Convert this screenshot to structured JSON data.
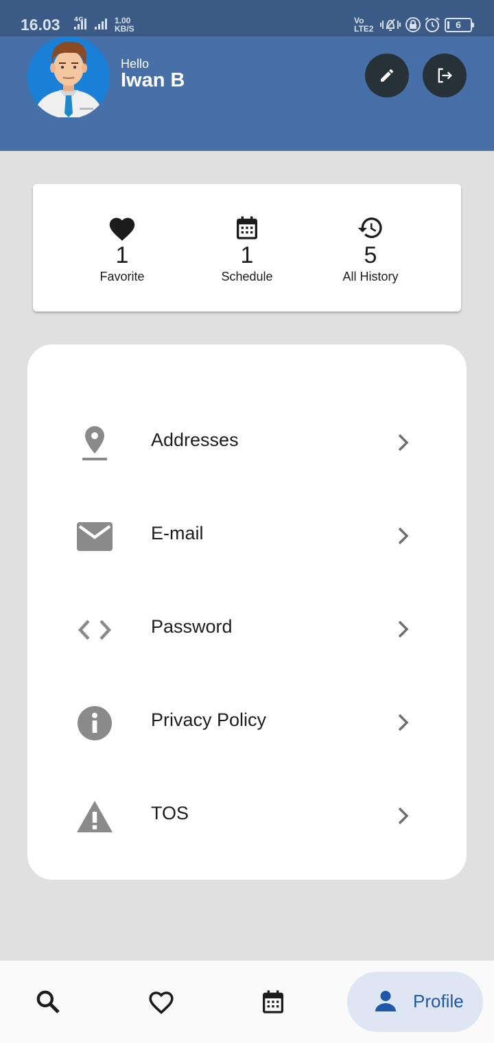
{
  "status_bar": {
    "time": "16.03",
    "network": "4G",
    "speed_value": "1.00",
    "speed_unit": "KB/S",
    "volte_top": "Vo",
    "volte_bottom": "LTE2",
    "battery": "6",
    "icons": [
      "signal-icon",
      "signal-icon",
      "vibrate-icon",
      "lock-icon",
      "alarm-icon",
      "battery-icon"
    ]
  },
  "header": {
    "greeting": "Hello",
    "user_name": "Iwan B",
    "edit_icon": "pencil-icon",
    "logout_icon": "logout-icon"
  },
  "stats": [
    {
      "icon": "heart-icon",
      "count": "1",
      "label": "Favorite"
    },
    {
      "icon": "calendar-icon",
      "count": "1",
      "label": "Schedule"
    },
    {
      "icon": "history-icon",
      "count": "5",
      "label": "All History"
    }
  ],
  "menu": [
    {
      "icon": "location-pin-icon",
      "label": "Addresses"
    },
    {
      "icon": "mail-icon",
      "label": "E-mail"
    },
    {
      "icon": "code-icon",
      "label": "Password"
    },
    {
      "icon": "info-icon",
      "label": "Privacy Policy"
    },
    {
      "icon": "warning-icon",
      "label": "TOS"
    }
  ],
  "bottom_nav": {
    "items": [
      {
        "icon": "search-icon"
      },
      {
        "icon": "heart-outline-icon"
      },
      {
        "icon": "calendar-icon"
      },
      {
        "icon": "person-icon",
        "label": "Profile",
        "active": true
      }
    ]
  },
  "colors": {
    "status_bar": "#3b5a86",
    "header": "#4870a8",
    "background": "#e0e0e0",
    "round_button": "#263238",
    "active_nav_pill": "#dde6f2",
    "active_nav_text": "#1f58a8",
    "menu_icon": "#8a8a8a"
  }
}
